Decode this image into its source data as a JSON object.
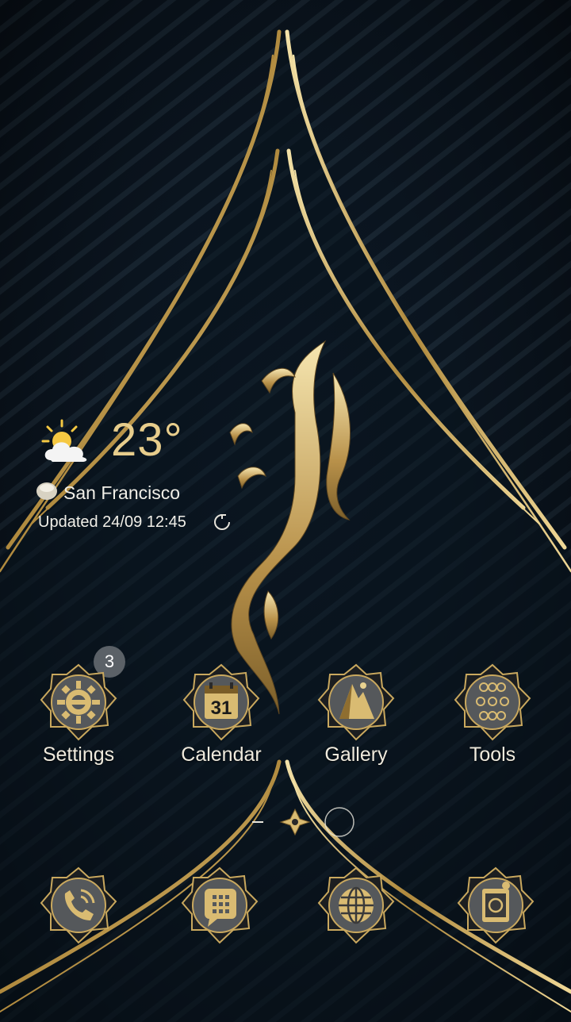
{
  "weather": {
    "temperature": "23°",
    "location": "San Francisco",
    "updated": "Updated 24/09 12:45",
    "condition_icon": "partly-cloudy-icon"
  },
  "notification_badge": "3",
  "apps": [
    {
      "label": "Settings",
      "icon": "settings-icon"
    },
    {
      "label": "Calendar",
      "icon": "calendar-icon",
      "icon_text": "31"
    },
    {
      "label": "Gallery",
      "icon": "gallery-icon"
    },
    {
      "label": "Tools",
      "icon": "tools-icon"
    }
  ],
  "dock": [
    {
      "icon": "phone-icon"
    },
    {
      "icon": "messages-icon"
    },
    {
      "icon": "browser-icon"
    },
    {
      "icon": "camera-icon"
    }
  ],
  "page_indicator": {
    "pages": 3,
    "current": 1
  },
  "colors": {
    "background": "#0c1620",
    "gold": "#d4b56a",
    "label": "#efeadd"
  }
}
